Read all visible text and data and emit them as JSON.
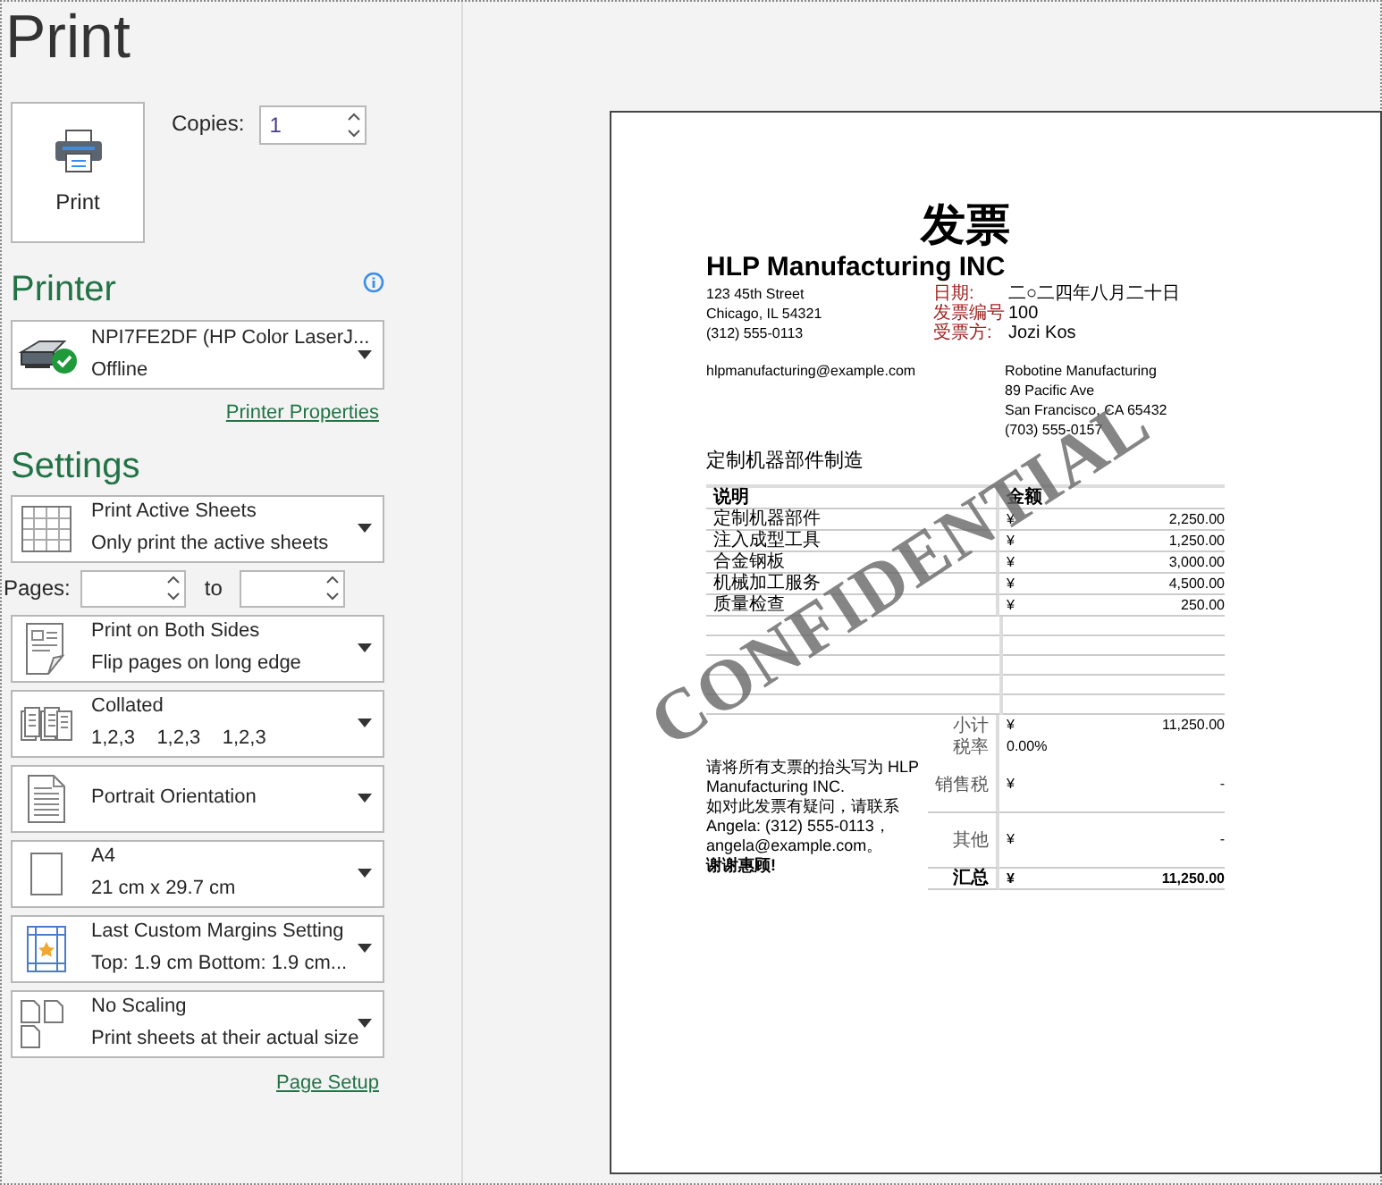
{
  "title": "Print",
  "print_button": {
    "label": "Print"
  },
  "copies": {
    "label": "Copies:",
    "value": "1"
  },
  "printer": {
    "heading": "Printer",
    "name": "NPI7FE2DF (HP Color LaserJ...",
    "status": "Offline",
    "properties_link": "Printer Properties"
  },
  "settings": {
    "heading": "Settings",
    "items": [
      {
        "kind": "sheets",
        "title": "Print Active Sheets",
        "subtitle": "Only print the active sheets"
      },
      {
        "kind": "pages",
        "label": "Pages:",
        "to": "to"
      },
      {
        "kind": "sides",
        "title": "Print on Both Sides",
        "subtitle": "Flip pages on long edge"
      },
      {
        "kind": "collate",
        "title": "Collated",
        "subtitle": "1,2,3    1,2,3    1,2,3"
      },
      {
        "kind": "orientation",
        "title": "Portrait Orientation"
      },
      {
        "kind": "paper",
        "title": "A4",
        "subtitle": "21 cm x 29.7 cm"
      },
      {
        "kind": "margins",
        "title": "Last Custom Margins Setting",
        "subtitle": "Top: 1.9 cm Bottom: 1.9 cm..."
      },
      {
        "kind": "scaling",
        "title": "No Scaling",
        "subtitle": "Print sheets at their actual size"
      }
    ],
    "page_setup_link": "Page Setup"
  },
  "preview": {
    "title": "发票",
    "company": "HLP Manufacturing INC",
    "address": [
      "123 45th Street",
      "Chicago, IL 54321",
      "(312) 555-0113"
    ],
    "fields": [
      {
        "label": "日期:",
        "value": "二○二四年八月二十日"
      },
      {
        "label": "发票编号",
        "value": "100"
      },
      {
        "label": "受票方:",
        "value": "Jozi Kos"
      }
    ],
    "email": "hlpmanufacturing@example.com",
    "customer": [
      "Robotine Manufacturing",
      "89 Pacific Ave",
      "San Francisco, CA 65432",
      "(703) 555-0157"
    ],
    "description": "定制机器部件制造",
    "columns": [
      "说明",
      "金额"
    ],
    "items": [
      {
        "description": "定制机器部件",
        "currency": "¥",
        "amount": "2,250.00"
      },
      {
        "description": "注入成型工具",
        "currency": "¥",
        "amount": "1,250.00"
      },
      {
        "description": "合金钢板",
        "currency": "¥",
        "amount": "3,000.00"
      },
      {
        "description": "机械加工服务",
        "currency": "¥",
        "amount": "4,500.00"
      },
      {
        "description": "质量检查",
        "currency": "¥",
        "amount": "250.00"
      }
    ],
    "summary": [
      {
        "label": "小计",
        "currency": "¥",
        "amount": "11,250.00",
        "total": false
      },
      {
        "label": "税率",
        "amount": "0.00%",
        "total": false
      },
      {
        "label": "销售税",
        "currency": "¥",
        "amount": "-",
        "total": false
      },
      {
        "label": "其他",
        "currency": "¥",
        "amount": "-",
        "total": false
      },
      {
        "label": "汇总",
        "currency": "¥",
        "amount": "11,250.00",
        "total": true
      }
    ],
    "note_lines": [
      "请将所有支票的抬头写为 HLP Manufacturing INC.",
      "如对此发票有疑问，请联系 Angela: (312) 555-0113，angela@example.com。"
    ],
    "closing": "谢谢惠顾!",
    "watermark": "CONFIDENTIAL"
  }
}
